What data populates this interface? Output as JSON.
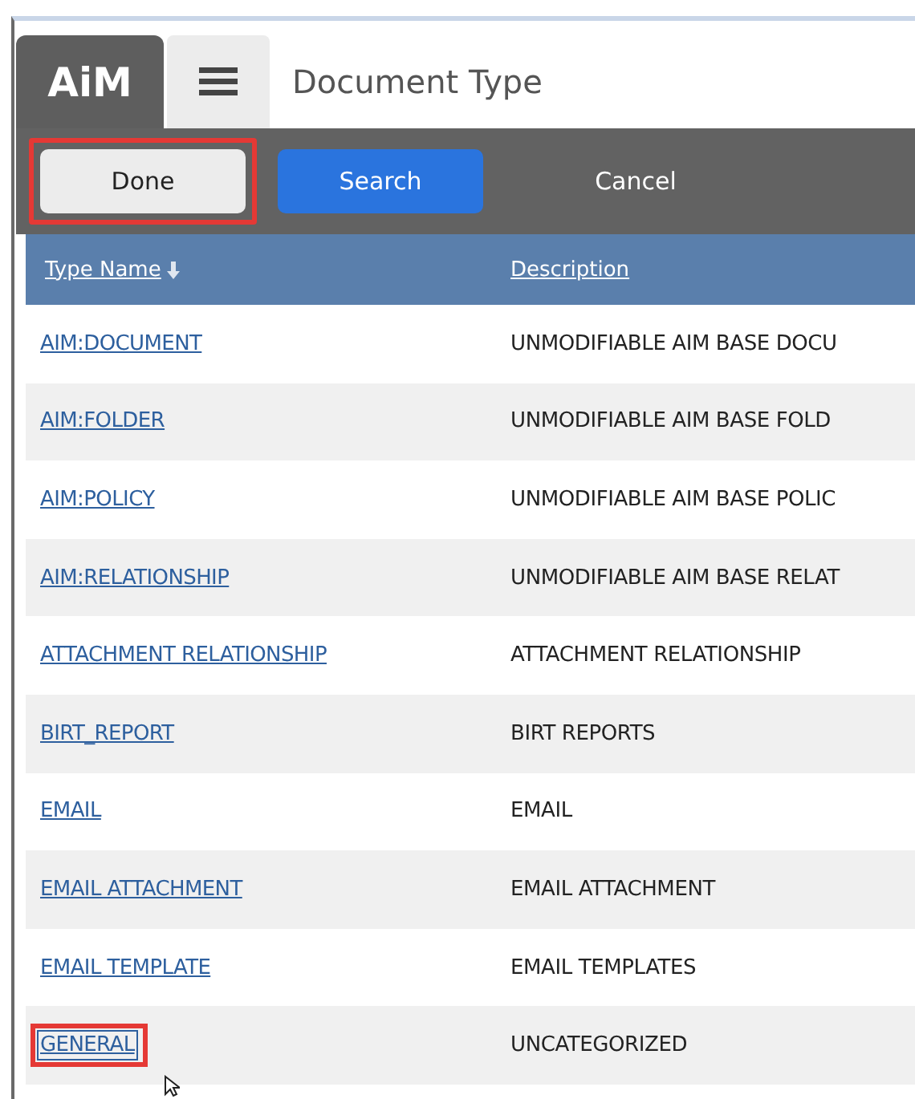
{
  "header": {
    "logo": "AiM",
    "title": "Document Type"
  },
  "toolbar": [
    {
      "label": "Done",
      "kind": "plain",
      "highlighted": true
    },
    {
      "label": "Search",
      "kind": "primary",
      "highlighted": false
    },
    {
      "label": "Cancel",
      "kind": "text",
      "highlighted": false
    }
  ],
  "table": {
    "columns": [
      {
        "label": "Type Name",
        "sorted": true
      },
      {
        "label": "Description",
        "sorted": false
      }
    ],
    "rows": [
      {
        "type_name": "AIM:DOCUMENT",
        "description": "UNMODIFIABLE AIM BASE DOCU",
        "highlighted": false
      },
      {
        "type_name": "AIM:FOLDER",
        "description": "UNMODIFIABLE AIM BASE FOLD",
        "highlighted": false
      },
      {
        "type_name": "AIM:POLICY",
        "description": "UNMODIFIABLE AIM BASE POLIC",
        "highlighted": false
      },
      {
        "type_name": "AIM:RELATIONSHIP",
        "description": "UNMODIFIABLE AIM BASE RELAT",
        "highlighted": false
      },
      {
        "type_name": "ATTACHMENT RELATIONSHIP",
        "description": "ATTACHMENT RELATIONSHIP",
        "highlighted": false
      },
      {
        "type_name": "BIRT_REPORT",
        "description": "BIRT REPORTS",
        "highlighted": false
      },
      {
        "type_name": "EMAIL",
        "description": "EMAIL",
        "highlighted": false
      },
      {
        "type_name": "EMAIL ATTACHMENT",
        "description": "EMAIL ATTACHMENT",
        "highlighted": false
      },
      {
        "type_name": "EMAIL TEMPLATE",
        "description": "EMAIL TEMPLATES",
        "highlighted": false
      },
      {
        "type_name": "GENERAL",
        "description": "UNCATEGORIZED",
        "highlighted": true
      }
    ]
  }
}
